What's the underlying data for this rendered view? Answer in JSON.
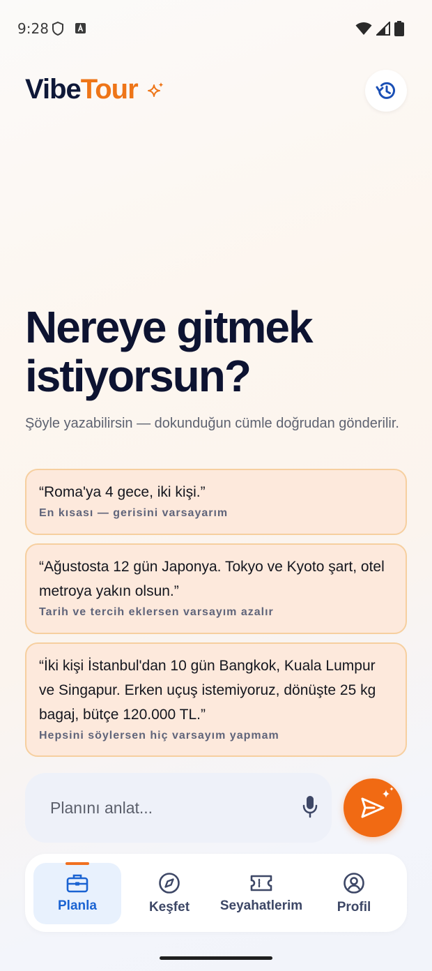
{
  "status_bar": {
    "time": "9:28",
    "icons": [
      "shield-icon",
      "a-box-icon",
      "wifi-icon",
      "signal-icon",
      "battery-icon"
    ]
  },
  "header": {
    "logo_part1": "Vibe",
    "logo_part2": "Tour",
    "history_icon": "history-icon"
  },
  "hero": {
    "title": "Nereye gitmek istiyorsun?",
    "subtitle": "Şöyle yazabilirsin — dokunduğun cümle doğrudan gönderilir."
  },
  "examples": [
    {
      "text": "“Roma'ya 4 gece, iki kişi.”",
      "hint": "En kısası — gerisini varsayarım"
    },
    {
      "text": "“Ağustosta 12 gün Japonya. Tokyo ve Kyoto şart, otel metroya yakın olsun.”",
      "hint": "Tarih ve tercih eklersen varsayım azalır"
    },
    {
      "text": "“İki kişi İstanbul'dan 10 gün Bangkok, Kuala Lumpur ve Singapur. Erken uçuş istemiyoruz, dönüşte 25 kg bagaj, bütçe 120.000 TL.”",
      "hint": "Hepsini söylersen hiç varsayım yapmam"
    }
  ],
  "composer": {
    "placeholder": "Planını anlat...",
    "value": ""
  },
  "nav": {
    "items": [
      {
        "label": "Planla",
        "icon": "briefcase-icon",
        "active": true
      },
      {
        "label": "Keşfet",
        "icon": "compass-icon",
        "active": false
      },
      {
        "label": "Seyahatlerim",
        "icon": "ticket-icon",
        "active": false
      },
      {
        "label": "Profil",
        "icon": "profile-icon",
        "active": false
      }
    ]
  },
  "colors": {
    "accent": "#ee7518",
    "primary_dark": "#0e1838",
    "nav_active": "#1a63d2",
    "card_bg": "#fde9dc",
    "card_border": "#f6cf9f"
  }
}
